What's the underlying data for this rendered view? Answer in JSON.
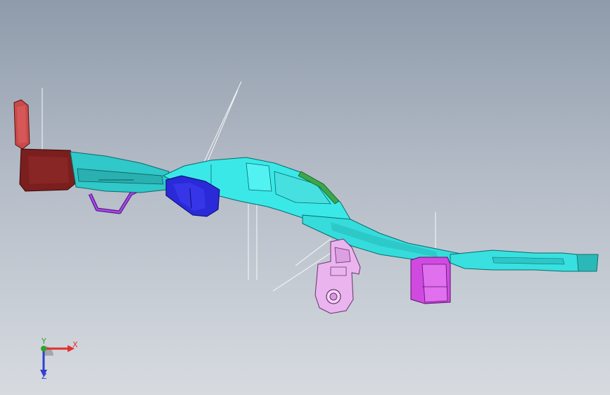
{
  "viewport": {
    "background_top": "#8f9bab",
    "background_bottom": "#d7dbe0"
  },
  "model": {
    "parts": [
      {
        "name": "red-tab-bracket",
        "color": "#c94a4a"
      },
      {
        "name": "dark-red-end-cap",
        "color": "#7a1e1e"
      },
      {
        "name": "cyan-main-beam",
        "color": "#39e6e6"
      },
      {
        "name": "blue-clip",
        "color": "#2a2ad8"
      },
      {
        "name": "purple-rod",
        "color": "#8a2ec8"
      },
      {
        "name": "green-strip",
        "color": "#3aa84a"
      },
      {
        "name": "pink-mount-bracket",
        "color": "#eab4ee"
      },
      {
        "name": "magenta-block",
        "color": "#d04ae0"
      }
    ]
  },
  "triad": {
    "x_label": "X",
    "y_label": "Y",
    "z_label": "Z",
    "x_color": "#e03030",
    "y_color": "#2aa52a",
    "z_color": "#3040d0"
  }
}
